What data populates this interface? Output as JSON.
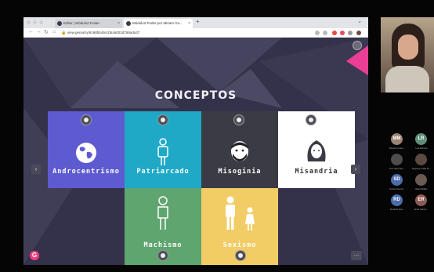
{
  "browser": {
    "tabs": [
      {
        "label": "Editor | Módulo2.Poder"
      },
      {
        "label": "Módulo2.Poder por Miriam Gu..."
      }
    ],
    "url": "view.genial.ly/6168bb49ccbb4a002d768ada37"
  },
  "slide": {
    "title": "CONCEPTOS",
    "cards": [
      {
        "label": "Androcentrismo",
        "color": "#5e5bd1",
        "icon": "globe-icon"
      },
      {
        "label": "Patriarcado",
        "color": "#1fa9c7",
        "icon": "man-icon"
      },
      {
        "label": "Misoginia",
        "color": "#3b3b45",
        "icon": "bearded-man-icon"
      },
      {
        "label": "Misandria",
        "color": "#ffffff",
        "icon": "woman-face-icon"
      },
      {
        "label": "Machismo",
        "color": "#5fa56f",
        "icon": "man-outline-icon"
      },
      {
        "label": "Sexismo",
        "color": "#f2cc65",
        "icon": "man-woman-icon"
      }
    ]
  },
  "participants": [
    {
      "initials": "MM",
      "name": "Marisol Gutie...",
      "color": "#9c8472"
    },
    {
      "initials": "LR",
      "name": "Lea Ramos",
      "color": "#5f8f7a"
    },
    {
      "initials": "",
      "name": "Jimi Sanchez...",
      "color": "#4d4d4d"
    },
    {
      "initials": "",
      "name": "Dayane Calla M...",
      "color": "#5a4a40"
    },
    {
      "initials": "SD",
      "name": "Sonia Gonzá...",
      "color": "#4a6cab"
    },
    {
      "initials": "",
      "name": "Elisa Millán",
      "color": "#6a5a52"
    },
    {
      "initials": "RD",
      "name": "Rodolfo Dia...",
      "color": "#4a6cab"
    },
    {
      "initials": "ER",
      "name": "Enki Sanch...",
      "color": "#8b5a54"
    }
  ]
}
